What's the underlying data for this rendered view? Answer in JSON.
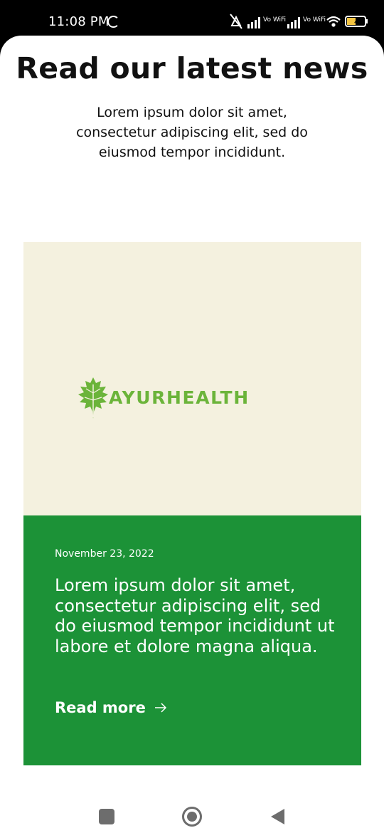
{
  "status_bar": {
    "time": "11:08 PM",
    "network_1": "Vo WiFi",
    "network_2": "Vo WiFi",
    "battery": "46"
  },
  "header": {
    "title": "Read our latest news",
    "subtitle": "Lorem ipsum dolor sit amet, consectetur adipiscing elit, sed do eiusmod tempor incididunt."
  },
  "card": {
    "logo_text": "AYURHEALTH",
    "date": "November 23, 2022",
    "headline": "Lorem ipsum dolor sit amet, consectetur adipiscing elit, sed do eiusmod tempor incididunt ut labore et dolore magna aliqua.",
    "link_label": "Read more",
    "colors": {
      "image_bg": "#f4f1df",
      "body_bg": "#1c9237",
      "logo": "#6bb43a"
    }
  },
  "nav_bar": {
    "icons": [
      "recent-apps-icon",
      "home-icon",
      "back-icon"
    ]
  }
}
